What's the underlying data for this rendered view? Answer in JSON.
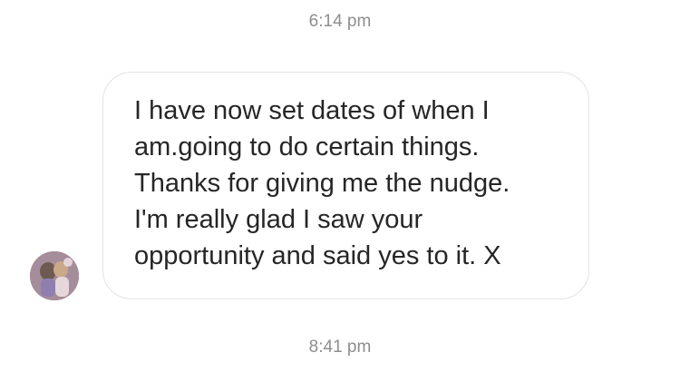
{
  "timestamps": {
    "top": "6:14 pm",
    "bottom": "8:41 pm"
  },
  "avatar": {
    "icon": "profile-photo-avatar"
  },
  "message": {
    "lines": [
      "I have now set dates of when I",
      "am.going to do certain things.",
      "Thanks for giving me the nudge.",
      "I'm really glad I saw your",
      "opportunity and said yes to it. X"
    ]
  }
}
